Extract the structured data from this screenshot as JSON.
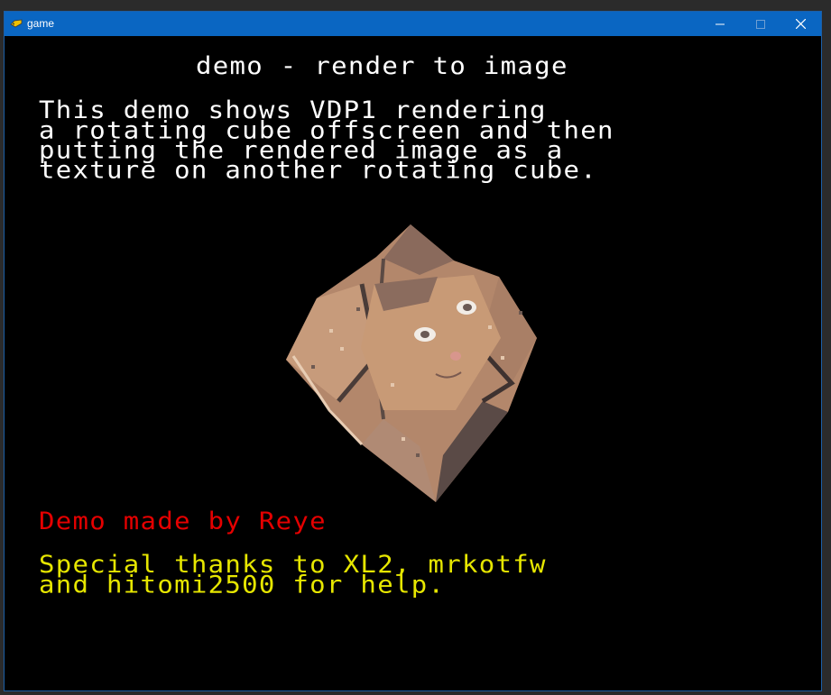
{
  "window": {
    "title": "game",
    "icon": "game-controller-icon"
  },
  "screen": {
    "heading": "demo - render to image",
    "description": "This demo shows VDP1 rendering\na rotating cube offscreen and then\nputting the rendered image as a\ntexture on another rotating cube.",
    "credit": "Demo made by Reye",
    "thanks": "Special thanks to XL2, mrkotfw\nand hitomi2500 for help."
  },
  "colors": {
    "titlebar": "#0a66c2",
    "heading_text": "#ffffff",
    "credit_text": "#e50000",
    "thanks_text": "#e6e600",
    "background": "#000000"
  }
}
